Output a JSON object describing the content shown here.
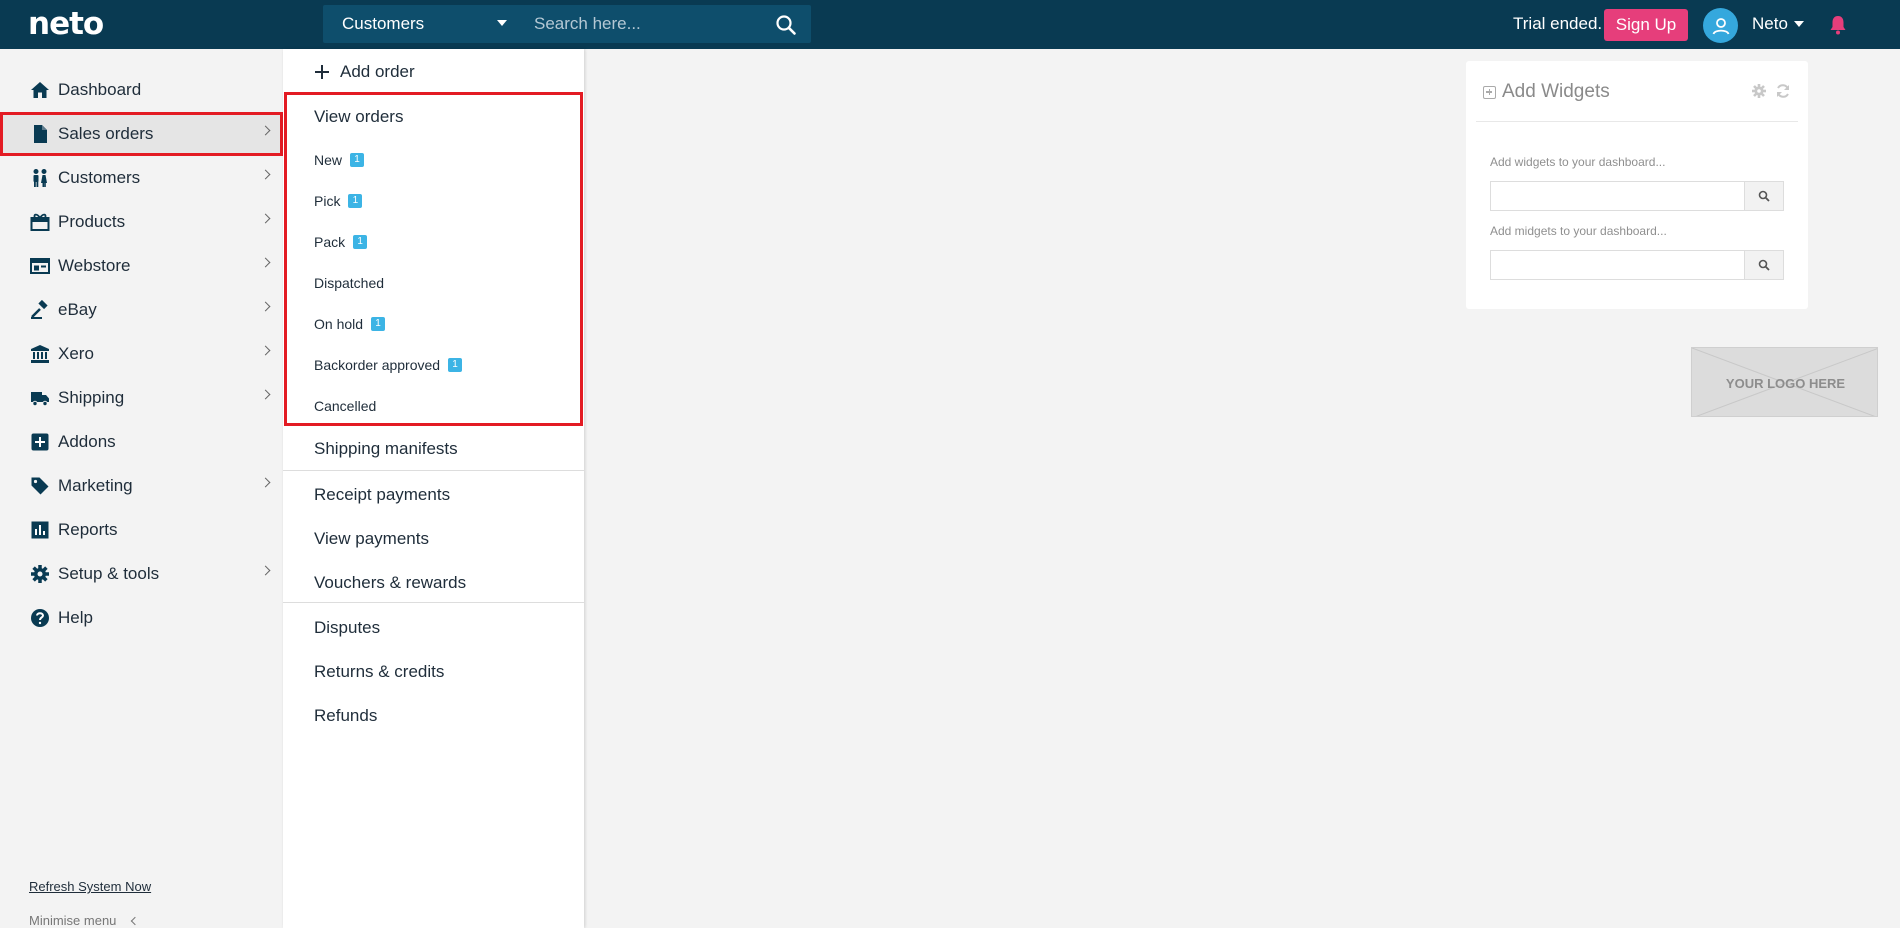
{
  "brand": {
    "logo": "neto"
  },
  "topbar": {
    "search_scope": "Customers",
    "search_placeholder": "Search here...",
    "trial_text": "Trial ended.",
    "signup_label": "Sign Up",
    "user_name": "Neto",
    "accent_color": "#e63e7b",
    "bar_color": "#093a52"
  },
  "sidebar": {
    "items": [
      {
        "label": "Dashboard",
        "icon": "home-icon",
        "has_submenu": false,
        "active": false
      },
      {
        "label": "Sales orders",
        "icon": "document-icon",
        "has_submenu": true,
        "active": true
      },
      {
        "label": "Customers",
        "icon": "people-icon",
        "has_submenu": true,
        "active": false
      },
      {
        "label": "Products",
        "icon": "gift-icon",
        "has_submenu": true,
        "active": false
      },
      {
        "label": "Webstore",
        "icon": "browser-icon",
        "has_submenu": true,
        "active": false
      },
      {
        "label": "eBay",
        "icon": "gavel-icon",
        "has_submenu": true,
        "active": false
      },
      {
        "label": "Xero",
        "icon": "bank-icon",
        "has_submenu": true,
        "active": false
      },
      {
        "label": "Shipping",
        "icon": "truck-icon",
        "has_submenu": true,
        "active": false
      },
      {
        "label": "Addons",
        "icon": "plus-square-icon",
        "has_submenu": false,
        "active": false
      },
      {
        "label": "Marketing",
        "icon": "tag-icon",
        "has_submenu": true,
        "active": false
      },
      {
        "label": "Reports",
        "icon": "bar-chart-icon",
        "has_submenu": false,
        "active": false
      },
      {
        "label": "Setup & tools",
        "icon": "gear-icon",
        "has_submenu": true,
        "active": false
      },
      {
        "label": "Help",
        "icon": "help-icon",
        "has_submenu": false,
        "active": false
      }
    ],
    "refresh_label": "Refresh System Now",
    "minimise_label": "Minimise menu"
  },
  "flyout": {
    "add_order": "Add order",
    "view_orders": "View orders",
    "statuses": [
      {
        "label": "New",
        "badge": "1"
      },
      {
        "label": "Pick",
        "badge": "1"
      },
      {
        "label": "Pack",
        "badge": "1"
      },
      {
        "label": "Dispatched",
        "badge": ""
      },
      {
        "label": "On hold",
        "badge": "1"
      },
      {
        "label": "Backorder approved",
        "badge": "1"
      },
      {
        "label": "Cancelled",
        "badge": ""
      }
    ],
    "shipping_manifests": "Shipping manifests",
    "group_payments": [
      "Receipt payments",
      "View payments",
      "Vouchers & rewards"
    ],
    "group_disputes": [
      "Disputes",
      "Returns & credits",
      "Refunds"
    ]
  },
  "widgets": {
    "title": "Add Widgets",
    "widgets_label": "Add widgets to your dashboard...",
    "midgets_label": "Add midgets to your dashboard...",
    "widgets_value": "",
    "midgets_value": ""
  },
  "logo_placeholder": "YOUR LOGO HERE"
}
